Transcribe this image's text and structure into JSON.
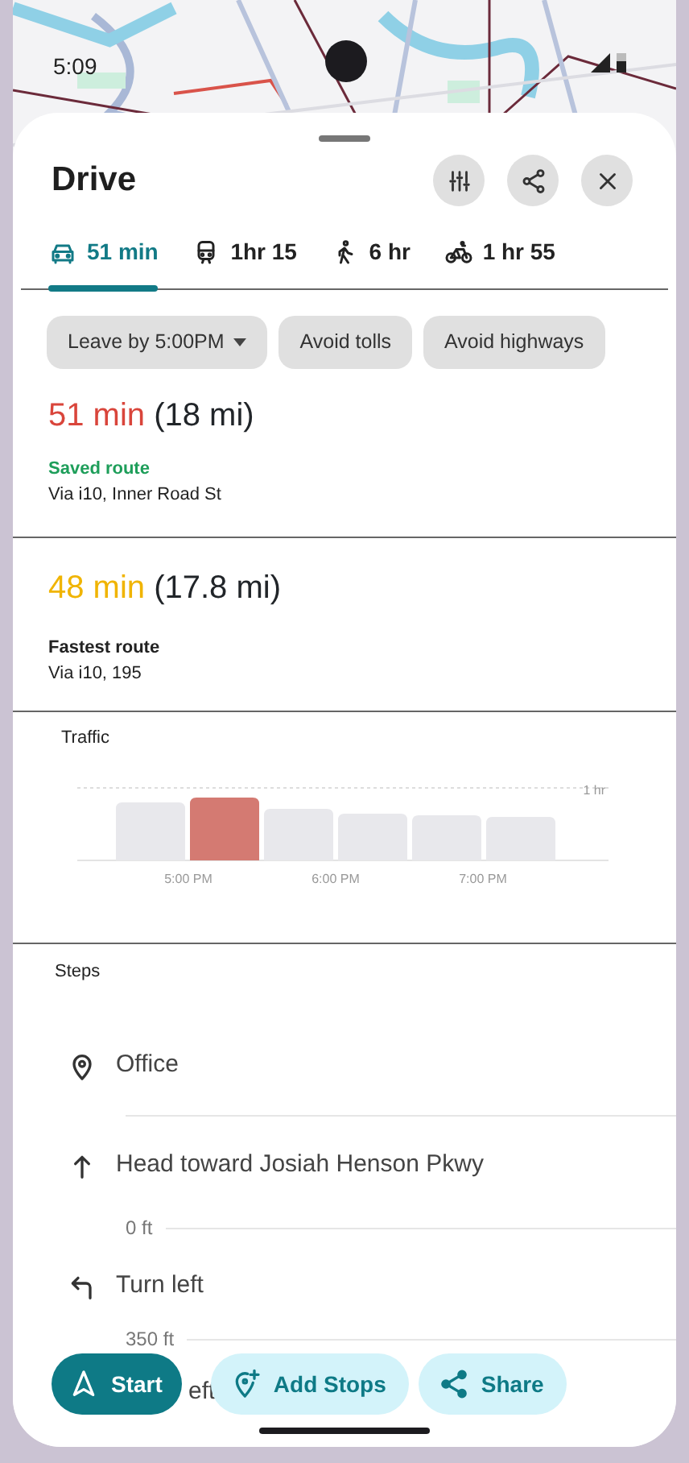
{
  "status_bar": {
    "time": "5:09"
  },
  "sheet": {
    "title": "Drive"
  },
  "header_buttons": [
    {
      "kind": "tune"
    },
    {
      "kind": "share"
    },
    {
      "kind": "close"
    }
  ],
  "tabs": [
    {
      "kind": "car",
      "label": "51 min",
      "selected": true
    },
    {
      "kind": "train",
      "label": "1hr 15",
      "selected": false
    },
    {
      "kind": "walk",
      "label": "6 hr",
      "selected": false
    },
    {
      "kind": "bike",
      "label": "1 hr 55",
      "selected": false
    }
  ],
  "chips": [
    {
      "label": "Leave by 5:00PM",
      "dropdown": true
    },
    {
      "label": "Avoid tolls",
      "dropdown": false
    },
    {
      "label": "Avoid highways",
      "dropdown": false
    }
  ],
  "routes": [
    {
      "time": "51 min",
      "distance": "(18 mi)",
      "color": "#d9453b",
      "name": "Saved route",
      "saved": true,
      "via": "Via i10, Inner Road St"
    },
    {
      "time": "48 min",
      "distance": "(17.8 mi)",
      "color": "#f0b400",
      "name": "Fastest route",
      "saved": false,
      "via": "Via i10, 195"
    }
  ],
  "traffic": {
    "title": "Traffic",
    "scale_label": "1 hr",
    "time_labels": [
      "5:00 PM",
      "6:00 PM",
      "7:00 PM"
    ],
    "bars": [
      {
        "selected": false
      },
      {
        "selected": true
      },
      {
        "selected": false
      },
      {
        "selected": false
      },
      {
        "selected": false
      },
      {
        "selected": false
      }
    ]
  },
  "steps": {
    "title": "Steps",
    "items": [
      {
        "kind": "place",
        "text": "Office"
      },
      {
        "kind": "straight",
        "text": "Head toward Josiah Henson Pkwy",
        "distance": "0 ft"
      },
      {
        "kind": "left",
        "text": "Turn left",
        "distance": "350 ft"
      },
      {
        "kind": "cut",
        "text": "eft"
      }
    ]
  },
  "actions": [
    {
      "kind": "start",
      "label": "Start",
      "primary": true
    },
    {
      "kind": "add",
      "label": "Add Stops",
      "primary": false
    },
    {
      "kind": "share",
      "label": "Share",
      "primary": false
    }
  ]
}
